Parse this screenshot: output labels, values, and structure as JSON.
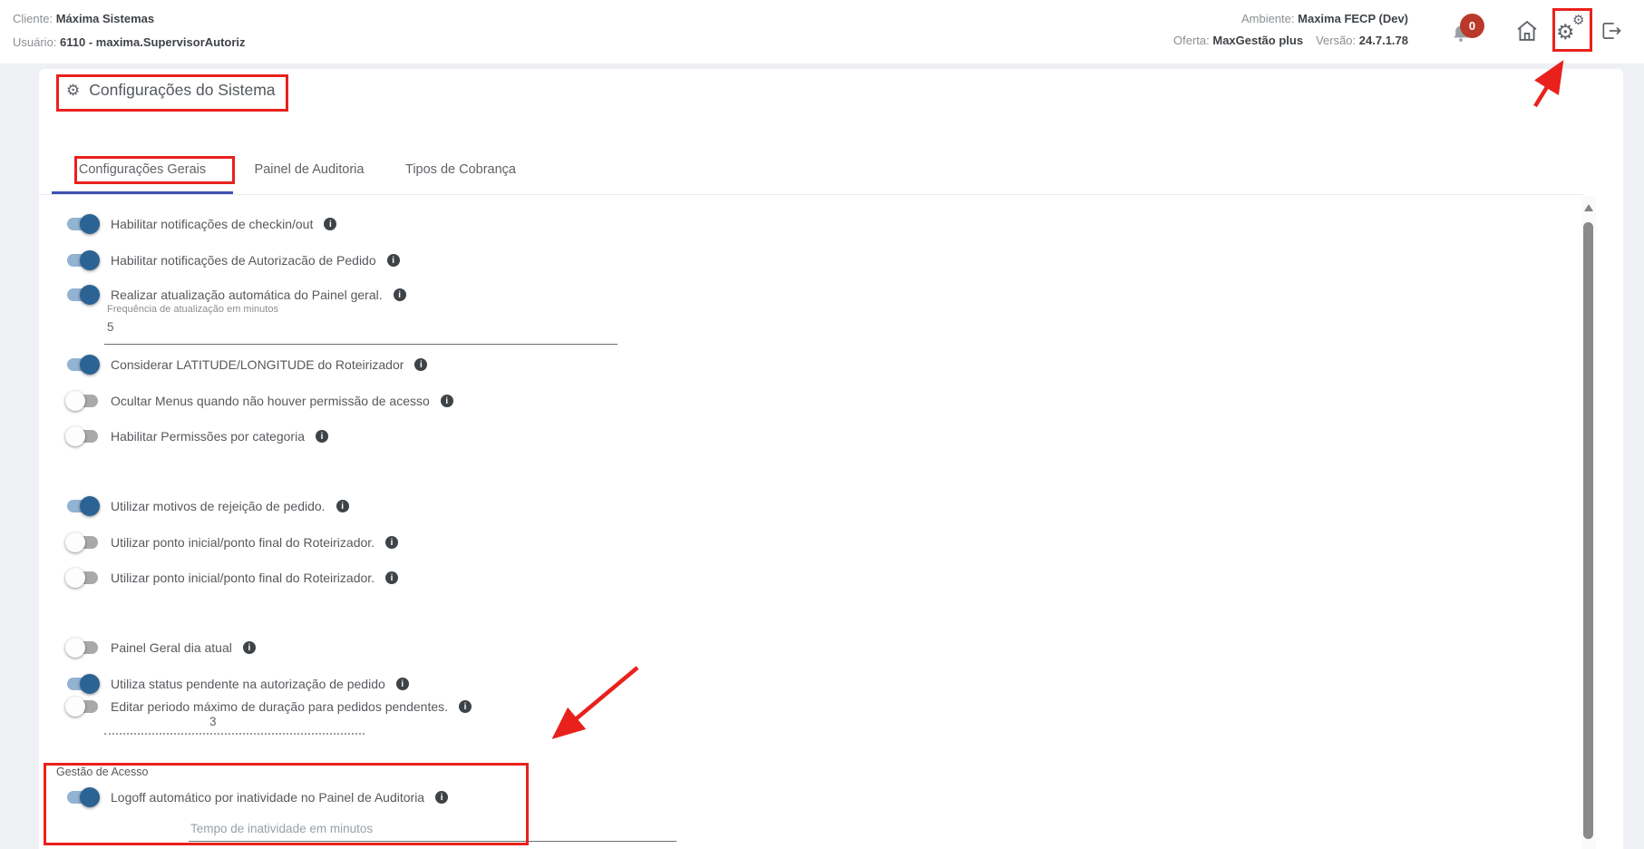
{
  "annotation_color": "#e9211c",
  "glyphs": {
    "gear": "⚙",
    "info": "i"
  },
  "header": {
    "client_label": "Cliente:",
    "client_value": "Máxima Sistemas",
    "user_label": "Usuário:",
    "user_value": "6110 - maxima.SupervisorAutoriz",
    "environment_label": "Ambiente:",
    "environment_value": "Maxima FECP (Dev)",
    "offer_label": "Oferta:",
    "offer_value": "MaxGestão plus",
    "version_label": "Versão:",
    "version_value": "24.7.1.78",
    "notification_count": "0"
  },
  "page_title": {
    "text": "Configurações do Sistema"
  },
  "tabs": [
    {
      "label": "Configurações Gerais",
      "active": true
    },
    {
      "label": "Painel de Auditoria",
      "active": false
    },
    {
      "label": "Tipos de Cobrança",
      "active": false
    }
  ],
  "settings": {
    "rows": [
      {
        "label": "Habilitar notificações de checkin/out",
        "state": "on"
      },
      {
        "label": "Habilitar notificações de Autorizacão de Pedido",
        "state": "on"
      },
      {
        "label": "Realizar atualização automática do Painel geral.",
        "state": "on"
      },
      {
        "label": "Considerar LATITUDE/LONGITUDE do Roteirizador",
        "state": "on"
      },
      {
        "label": "Ocultar Menus quando não houver permissão de acesso",
        "state": "off"
      },
      {
        "label": "Habilitar Permissões por categoria",
        "state": "off"
      },
      {
        "label": "Utilizar motivos de rejeição de pedido.",
        "state": "on"
      },
      {
        "label": "Utilizar ponto inicial/ponto final do Roteirizador.",
        "state": "off"
      },
      {
        "label": "Utilizar ponto inicial/ponto final do Roteirizador.",
        "state": "off"
      },
      {
        "label": "Painel Geral dia atual",
        "state": "off"
      },
      {
        "label": "Utiliza status pendente na autorização de pedido",
        "state": "on"
      },
      {
        "label": "Editar periodo máximo de duração para pedidos pendentes.",
        "state": "off"
      }
    ],
    "frequency_field": {
      "label": "Frequência de atualização em minutos",
      "value": "5"
    },
    "pending_days_field": {
      "value": "3"
    },
    "access_section": {
      "title": "Gestão de Acesso",
      "row": {
        "label": "Logoff automático por inatividade no Painel de Auditoria",
        "state": "on"
      },
      "inactivity_field": {
        "placeholder": "Tempo de inatividade em minutos"
      }
    }
  }
}
